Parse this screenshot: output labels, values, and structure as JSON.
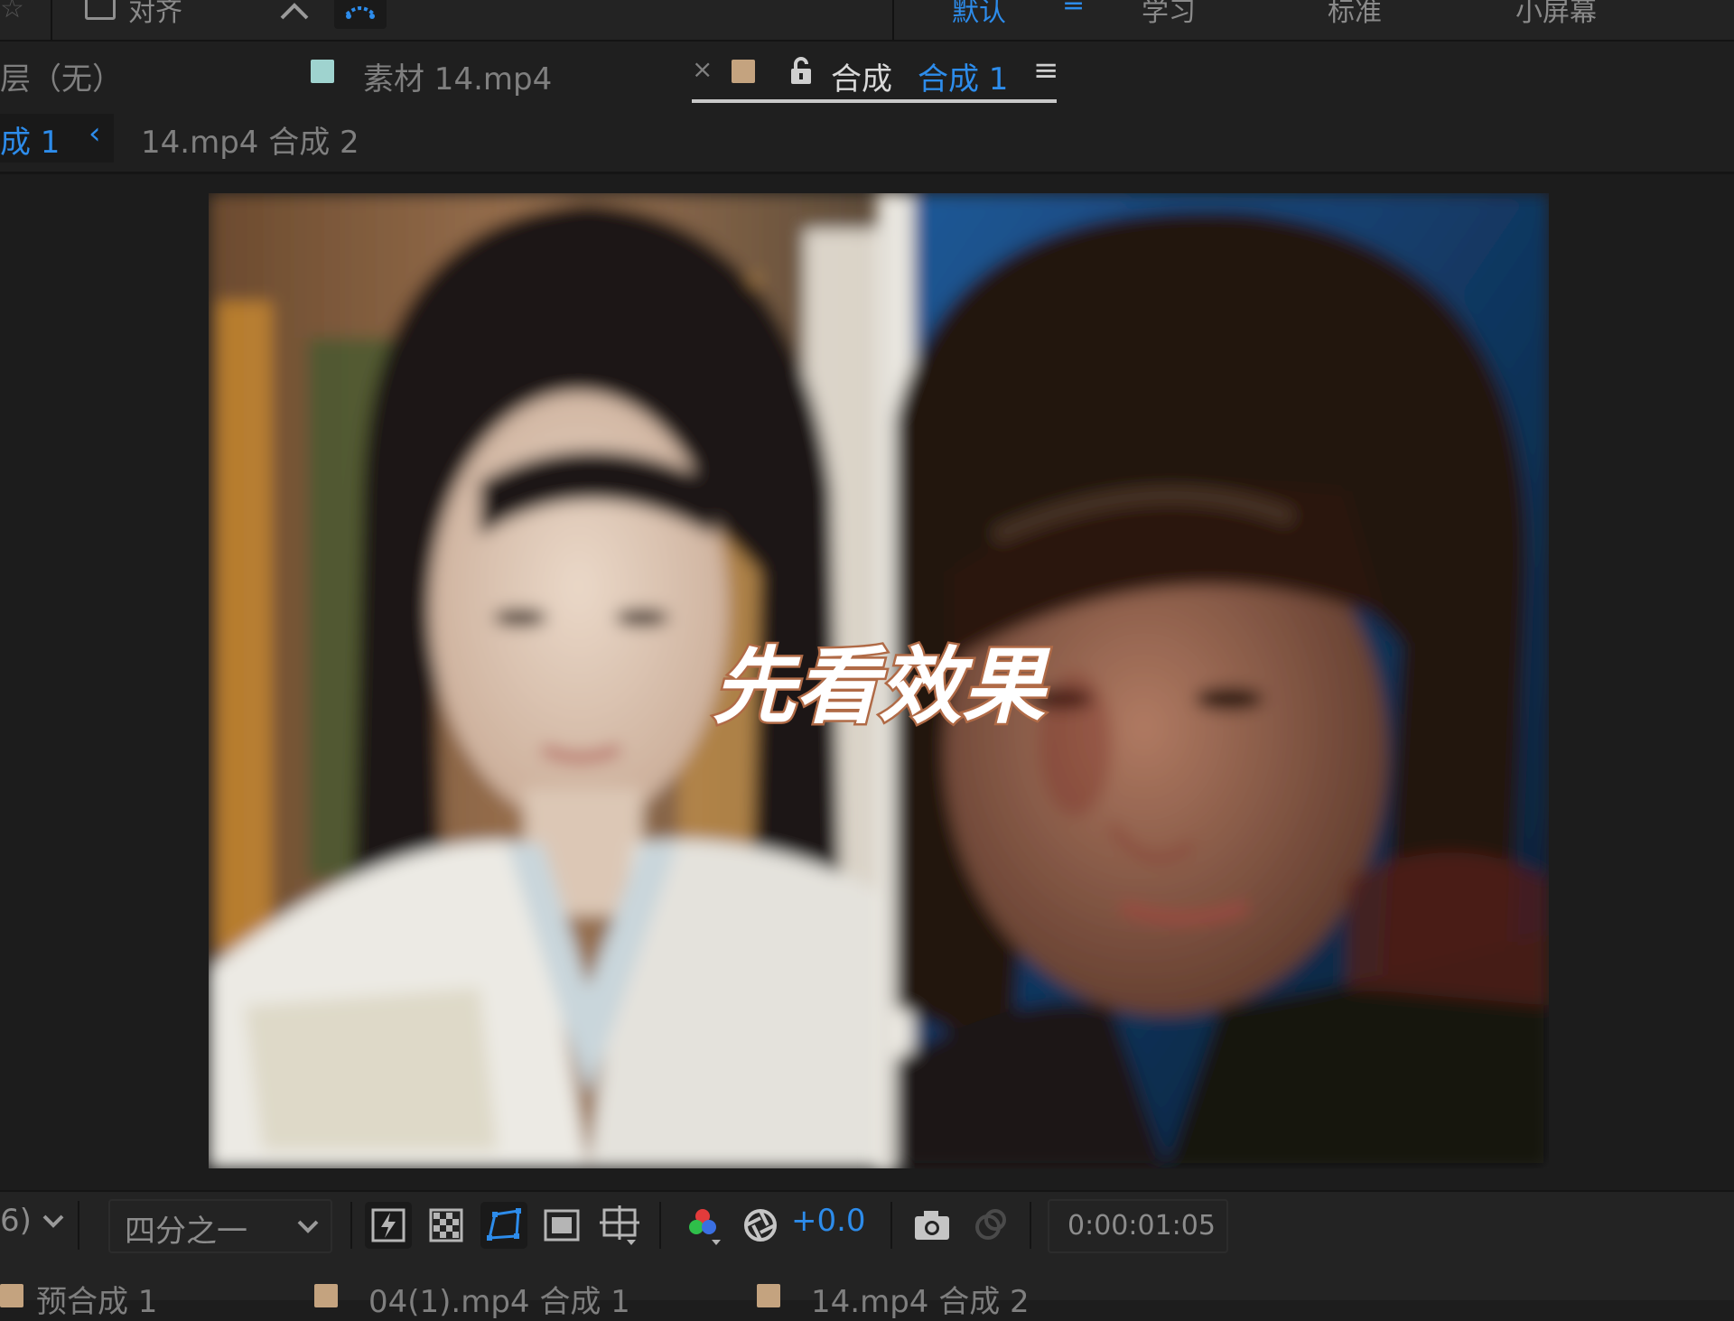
{
  "workspace": {
    "align_label": "对齐",
    "default_label": "默认",
    "menu_glyph": "≡",
    "learn_label": "学习",
    "standard_label": "标准",
    "small_screen_label": "小屏幕"
  },
  "panels": {
    "layer_label": "层（无）",
    "footage_label": "素材 14.mp4",
    "footage_swatch": "#9fd3cf",
    "comp_close": "×",
    "comp_swatch": "#c4a37f",
    "comp_prefix": "合成",
    "comp_name": "合成 1",
    "panel_menu": "≡"
  },
  "breadcrumb": {
    "current": "成 1",
    "arrow": "‹",
    "next": "14.mp4 合成 2"
  },
  "viewer": {
    "overlay_text": "先看效果",
    "left_icons": [
      "pen-icon",
      "grid-icon"
    ]
  },
  "toolbar": {
    "zoom_partial": "6)",
    "resolution": "四分之一",
    "exposure": "+0.0",
    "timecode": "0:00:01:05"
  },
  "project": {
    "items": [
      "预合成 1",
      "04(1).mp4 合成 1",
      "14.mp4 合成 2"
    ]
  },
  "colors": {
    "accent": "#2d8ceb",
    "panel_bg": "#1f1f1f",
    "viewer_bg": "#1c1c1c"
  }
}
